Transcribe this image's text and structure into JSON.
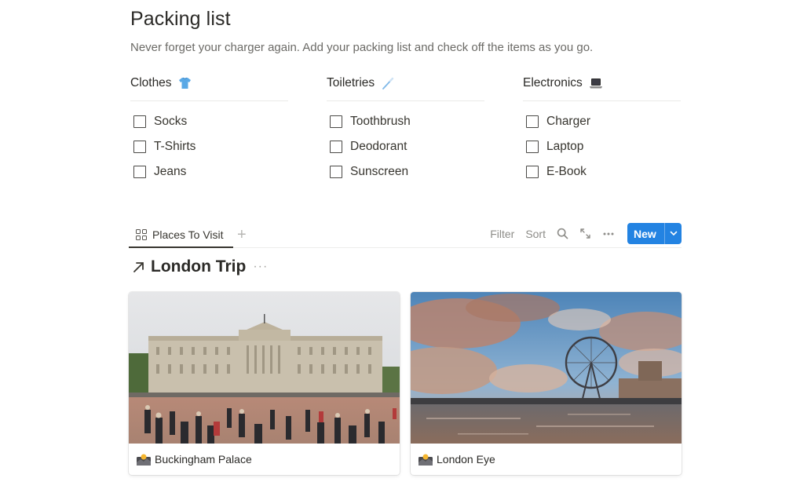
{
  "page": {
    "title": "Packing list",
    "description": "Never forget your charger again. Add your packing list and check off the items as you go."
  },
  "columns": [
    {
      "heading": "Clothes",
      "icon": "t-shirt-icon",
      "items": [
        {
          "label": "Socks",
          "checked": false
        },
        {
          "label": "T-Shirts",
          "checked": false
        },
        {
          "label": "Jeans",
          "checked": false
        }
      ]
    },
    {
      "heading": "Toiletries",
      "icon": "toothbrush-icon",
      "items": [
        {
          "label": "Toothbrush",
          "checked": false
        },
        {
          "label": "Deodorant",
          "checked": false
        },
        {
          "label": "Sunscreen",
          "checked": false
        }
      ]
    },
    {
      "heading": "Electronics",
      "icon": "laptop-icon",
      "items": [
        {
          "label": "Charger",
          "checked": false
        },
        {
          "label": "Laptop",
          "checked": false
        },
        {
          "label": "E-Book",
          "checked": false
        }
      ]
    }
  ],
  "database": {
    "tabs": [
      {
        "label": "Places To Visit",
        "icon": "gallery-view-icon",
        "active": true
      }
    ],
    "add_view_label": "+",
    "actions": {
      "filter": "Filter",
      "sort": "Sort",
      "search_icon": "search-icon",
      "expand_icon": "expand-icon",
      "more_icon": "more-icon",
      "new_label": "New"
    },
    "title": "London Trip",
    "title_more": "···",
    "accent_color": "#2383e2",
    "cards": [
      {
        "title": "Buckingham Palace",
        "icon": "photo-icon",
        "image": "Buckingham Palace with crowds in the forecourt"
      },
      {
        "title": "London Eye",
        "icon": "photo-icon",
        "image": "London Eye by the Thames under dramatic clouds"
      }
    ]
  }
}
